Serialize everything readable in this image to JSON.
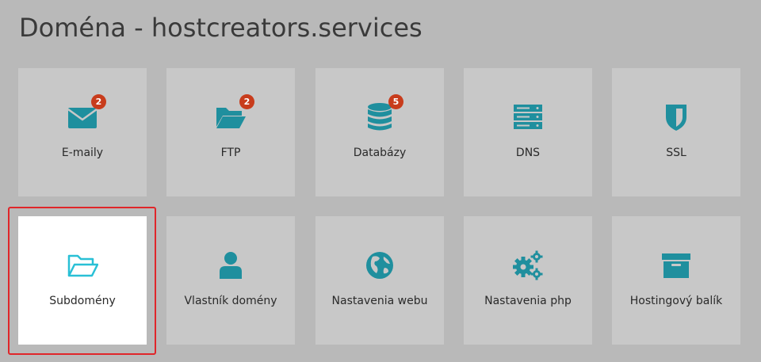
{
  "page": {
    "title": "Doména - hostcreators.services"
  },
  "colors": {
    "background": "#b9b9b9",
    "tile": "#c8c8c8",
    "tile_active": "#ffffff",
    "icon_accent": "#1f8f9e",
    "icon_light": "#29c0d6",
    "badge": "#c83c1c",
    "highlight_border": "#e0262a"
  },
  "tiles": [
    {
      "label": "E-maily",
      "icon": "envelope-icon",
      "badge": "2"
    },
    {
      "label": "FTP",
      "icon": "folder-open-icon",
      "badge": "2"
    },
    {
      "label": "Databázy",
      "icon": "database-icon",
      "badge": "5"
    },
    {
      "label": "DNS",
      "icon": "server-icon",
      "badge": null
    },
    {
      "label": "SSL",
      "icon": "shield-icon",
      "badge": null
    },
    {
      "label": "Subdomény",
      "icon": "folder-outline-icon",
      "badge": null,
      "selected": true
    },
    {
      "label": "Vlastník domény",
      "icon": "user-icon",
      "badge": null
    },
    {
      "label": "Nastavenia webu",
      "icon": "globe-icon",
      "badge": null
    },
    {
      "label": "Nastavenia php",
      "icon": "gears-icon",
      "badge": null
    },
    {
      "label": "Hostingový balík",
      "icon": "archive-box-icon",
      "badge": null
    }
  ]
}
